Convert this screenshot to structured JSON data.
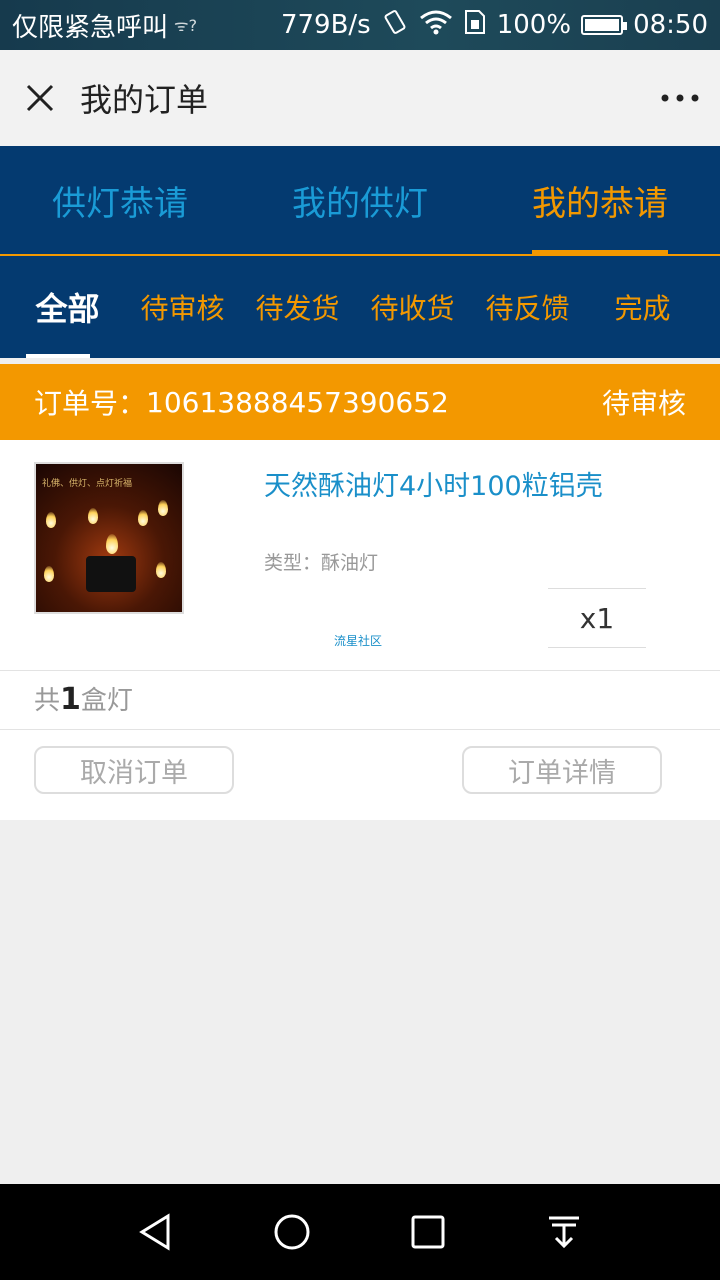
{
  "status_bar": {
    "carrier": "仅限紧急呼叫",
    "speed": "779B/s",
    "battery": "100%",
    "time": "08:50"
  },
  "app_bar": {
    "title": "我的订单"
  },
  "main_tabs": [
    {
      "label": "供灯恭请",
      "active": false
    },
    {
      "label": "我的供灯",
      "active": false
    },
    {
      "label": "我的恭请",
      "active": true
    }
  ],
  "sub_tabs": [
    {
      "label": "全部",
      "active": true
    },
    {
      "label": "待审核",
      "active": false
    },
    {
      "label": "待发货",
      "active": false
    },
    {
      "label": "待收货",
      "active": false
    },
    {
      "label": "待反馈",
      "active": false
    },
    {
      "label": "完成",
      "active": false
    }
  ],
  "order": {
    "number_label": "订单号：",
    "number": "10613888457390652",
    "status": "待审核",
    "thumbnail_caption": "礼佛、供灯、点灯祈福",
    "product_title": "天然酥油灯4小时100粒铝壳",
    "type_label": "类型：",
    "type_value": "酥油灯",
    "watermark": "流星社区",
    "quantity": "x1",
    "summary_prefix": "共",
    "summary_count": "1",
    "summary_suffix": "盒灯",
    "cancel_label": "取消订单",
    "detail_label": "订单详情"
  },
  "colors": {
    "navy": "#043a70",
    "orange": "#f39800",
    "blue_text": "#1a9bd6"
  }
}
